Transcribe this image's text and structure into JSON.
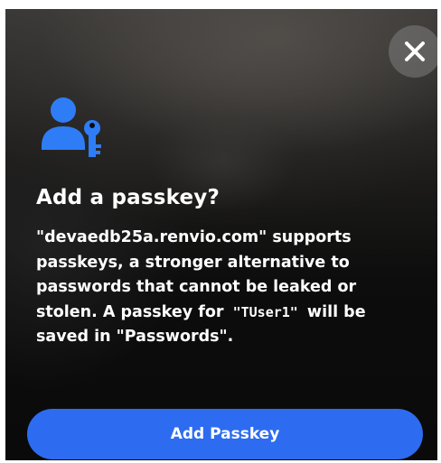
{
  "sheet": {
    "title": "Add a passkey?",
    "message_part1": "\"devaedb25a.renvio.com\" supports passkeys, a stronger alternative to passwords that cannot be leaked or stolen. A passkey for",
    "username": "\"TUser1\"",
    "message_part2": "will be saved in \"Passwords\".",
    "primary_button_label": "Add Passkey",
    "close_icon": "close-x-icon",
    "header_icon": "person-with-key-icon"
  },
  "colors": {
    "accent": "#2d6cf0",
    "icon_blue": "#2f7df6",
    "text": "#ffffff",
    "close_circle": "#7d7d7d"
  }
}
